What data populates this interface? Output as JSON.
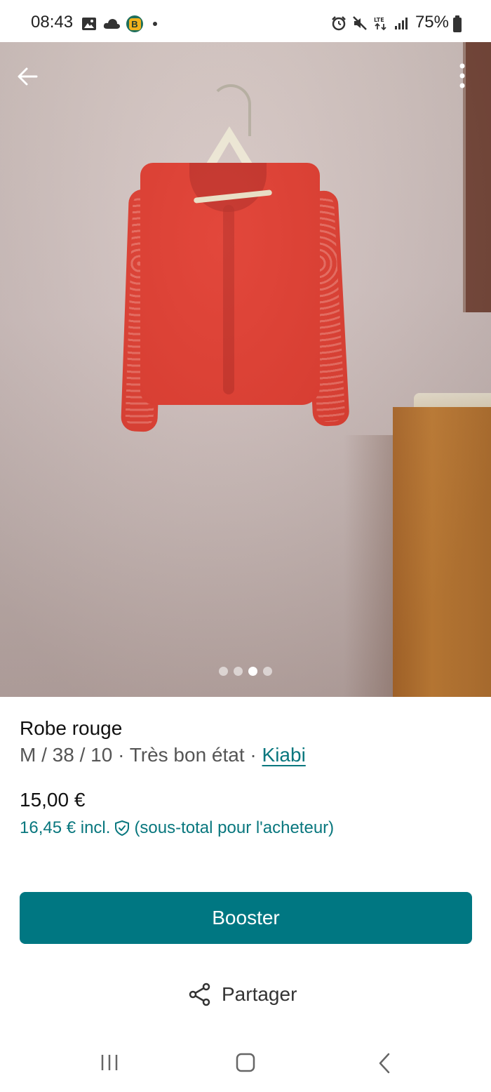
{
  "status_bar": {
    "time": "08:43",
    "battery": "75%",
    "left_icons": [
      "image-icon",
      "cloud-icon",
      "b-app-icon",
      "dot-icon"
    ],
    "right_icons": [
      "alarm-icon",
      "mute-icon",
      "lte-icon",
      "signal-icon",
      "battery-icon"
    ],
    "b_badge": "B"
  },
  "photo": {
    "page_indicator": {
      "total": 4,
      "active_index": 2
    }
  },
  "item": {
    "title": "Robe rouge",
    "size": "M / 38 / 10",
    "separator": "·",
    "condition": "Très bon état",
    "brand": "Kiabi",
    "price": "15,00 €",
    "buyer_total": "16,45 €",
    "buyer_incl": "incl.",
    "buyer_note": "(sous-total pour l'acheteur)"
  },
  "actions": {
    "booster_label": "Booster",
    "share_label": "Partager"
  },
  "colors": {
    "accent": "#007782",
    "link": "#09777e"
  }
}
